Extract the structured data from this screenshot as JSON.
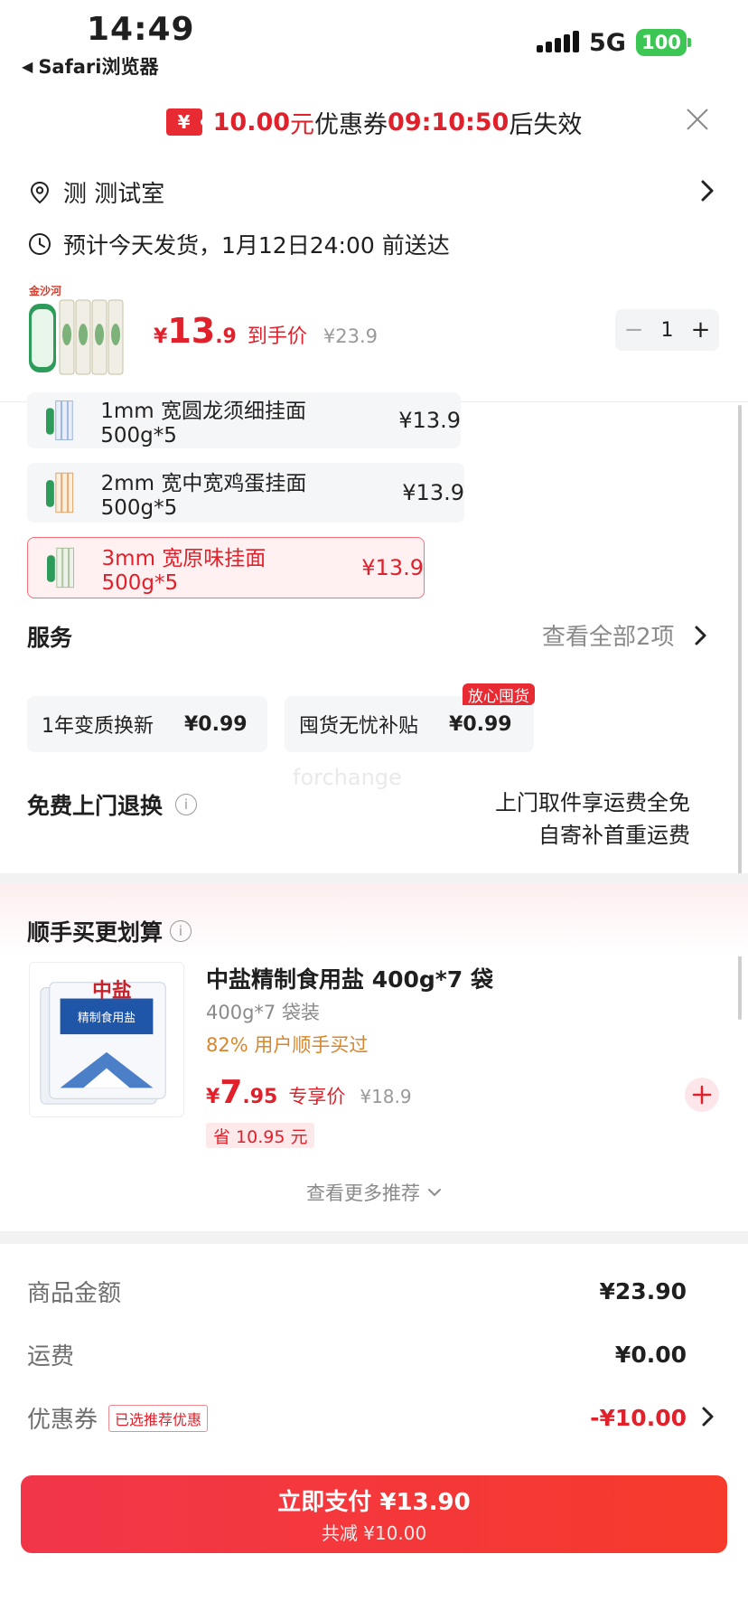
{
  "status_bar": {
    "time": "14:49",
    "back_app": "Safari浏览器",
    "network": "5G",
    "battery": "100"
  },
  "coupon_banner": {
    "icon_text": "¥",
    "amount": "10.00",
    "unit": "元",
    "label": "优惠券",
    "countdown": "09:10:50",
    "suffix": "后失效"
  },
  "address": {
    "name": "测  测试室"
  },
  "delivery": {
    "text": "预计今天发货，1月12日24:00 前送达"
  },
  "product": {
    "currency": "¥",
    "price_int": "13",
    "price_dec": ".9",
    "price_label": "到手价",
    "original_price": "¥23.9",
    "quantity": "1",
    "brand_color": "#e0202a"
  },
  "variants": [
    {
      "name": "1mm 宽圆龙须细挂面 500g*5",
      "price": "¥13.9",
      "selected": false
    },
    {
      "name": "2mm 宽中宽鸡蛋挂面 500g*5",
      "price": "¥13.9",
      "selected": false
    },
    {
      "name": "3mm 宽原味挂面 500g*5",
      "price": "¥13.9",
      "selected": true
    }
  ],
  "services": {
    "title": "服务",
    "view_all": "查看全部2项",
    "items": [
      {
        "name": "1年变质换新",
        "price": "¥0.99"
      },
      {
        "name": "囤货无忧补贴",
        "price": "¥0.99",
        "tag": "放心囤货"
      }
    ]
  },
  "free_return": {
    "title": "免费上门退换",
    "info_icon": "i",
    "line1": "上门取件享运费全免",
    "line2": "自寄补首重运费"
  },
  "watermark": "forchange",
  "recommend": {
    "title": "顺手买更划算",
    "info_icon": "i",
    "item": {
      "name": "中盐精制食用盐 400g*7 袋",
      "spec": "400g*7 袋装",
      "bought": "82% 用户顺手买过",
      "currency": "¥",
      "price_int": "7",
      "price_dec": ".95",
      "price_label": "专享价",
      "original_price": "¥18.9",
      "save": "省 10.95 元"
    },
    "more": "查看更多推荐"
  },
  "summary": {
    "goods_label": "商品金额",
    "goods_value": "¥23.90",
    "shipping_label": "运费",
    "shipping_value": "¥0.00",
    "coupon_label": "优惠券",
    "coupon_badge": "已选推荐优惠",
    "coupon_value": "-¥10.00"
  },
  "pay_button": {
    "label": "立即支付 ¥13.90",
    "sub": "共减 ¥10.00"
  }
}
